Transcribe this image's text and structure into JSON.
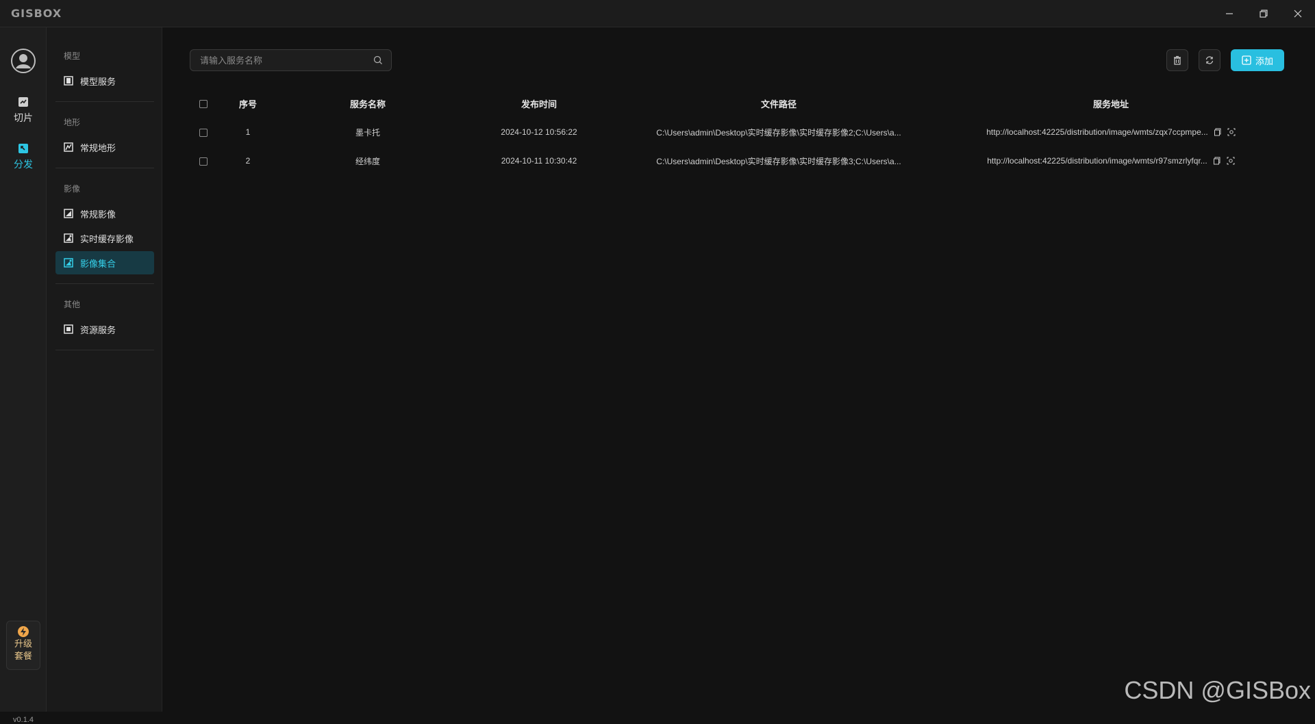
{
  "app": {
    "logo": "GISBOX"
  },
  "window": {
    "controls": [
      "minimize-icon",
      "restore-icon",
      "close-icon"
    ]
  },
  "rail": {
    "items": [
      {
        "label": "切片",
        "icon": "slice-icon",
        "active": false
      },
      {
        "label": "分发",
        "icon": "distribute-icon",
        "active": true
      }
    ],
    "upgrade": {
      "line1": "升级",
      "line2": "套餐",
      "icon": "bolt-icon"
    },
    "version": "v0.1.4"
  },
  "subnav": {
    "groups": [
      {
        "title": "模型",
        "items": [
          {
            "label": "模型服务"
          }
        ]
      },
      {
        "title": "地形",
        "items": [
          {
            "label": "常规地形"
          }
        ]
      },
      {
        "title": "影像",
        "items": [
          {
            "label": "常规影像"
          },
          {
            "label": "实时缓存影像"
          },
          {
            "label": "影像集合"
          }
        ]
      },
      {
        "title": "其他",
        "items": [
          {
            "label": "资源服务"
          }
        ]
      }
    ],
    "active_item": "影像集合"
  },
  "toolbar": {
    "search_placeholder": "请输入服务名称",
    "add_label": "添加"
  },
  "table": {
    "headers": [
      "序号",
      "服务名称",
      "发布时间",
      "文件路径",
      "服务地址"
    ],
    "rows": [
      {
        "index": "1",
        "name": "墨卡托",
        "time": "2024-10-12 10:56:22",
        "path": "C:\\Users\\admin\\Desktop\\实时缓存影像\\实时缓存影像2;C:\\Users\\a...",
        "url": "http://localhost:42225/distribution/image/wmts/zqx7ccpmpe..."
      },
      {
        "index": "2",
        "name": "经纬度",
        "time": "2024-10-11 10:30:42",
        "path": "C:\\Users\\admin\\Desktop\\实时缓存影像\\实时缓存影像3;C:\\Users\\a...",
        "url": "http://localhost:42225/distribution/image/wmts/r97smzrlyfqr..."
      }
    ]
  },
  "watermark": "CSDN @GISBox",
  "colors": {
    "accent": "#2dc6e3",
    "active_bg": "#173a44",
    "background": "#121212"
  }
}
